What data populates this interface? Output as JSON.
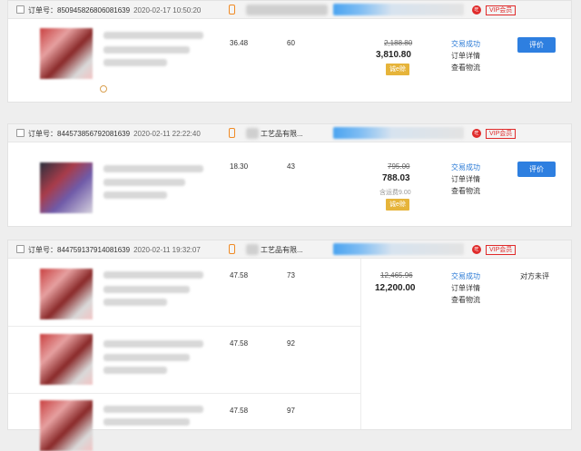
{
  "orders": [
    {
      "order_no": "订单号：850945826806081639",
      "date": "2020-02-17 10:50:20",
      "shop": "",
      "vip": "VIP会员",
      "unit_price": "36.48",
      "quantity": "60",
      "original_total": "2,188.80",
      "paid_total": "3,810.80",
      "shipping_note": "",
      "tag": "诚e赊",
      "status": "交易成功",
      "detail_link": "订单详情",
      "logistics_link": "查看物流",
      "action": "评价"
    },
    {
      "order_no": "订单号：844573856792081639",
      "date": "2020-02-11 22:22:40",
      "shop": "工艺品有限...",
      "vip": "VIP会员",
      "unit_price": "18.30",
      "quantity": "43",
      "original_total": "795.00",
      "paid_total": "788.03",
      "shipping_note": "含运费9.00",
      "tag": "诚e赊",
      "status": "交易成功",
      "detail_link": "订单详情",
      "logistics_link": "查看物流",
      "action": "评价"
    },
    {
      "order_no": "订单号：844759137914081639",
      "date": "2020-02-11 19:32:07",
      "shop": "工艺品有限...",
      "vip": "VIP会员",
      "items": [
        {
          "unit_price": "47.58",
          "quantity": "73"
        },
        {
          "unit_price": "47.58",
          "quantity": "92"
        },
        {
          "unit_price": "47.58",
          "quantity": "97"
        }
      ],
      "original_total": "12,465.96",
      "paid_total": "12,200.00",
      "status": "交易成功",
      "detail_link": "订单详情",
      "logistics_link": "查看物流",
      "review_status": "对方未评"
    }
  ],
  "colors": {
    "accent_blue": "#2e7fe0",
    "vip_red": "#e02b2b",
    "tag_gold": "#e6b43a"
  },
  "icons": [
    "checkbox-icon",
    "mobile-phone-icon",
    "wangwang-chat-icon"
  ]
}
